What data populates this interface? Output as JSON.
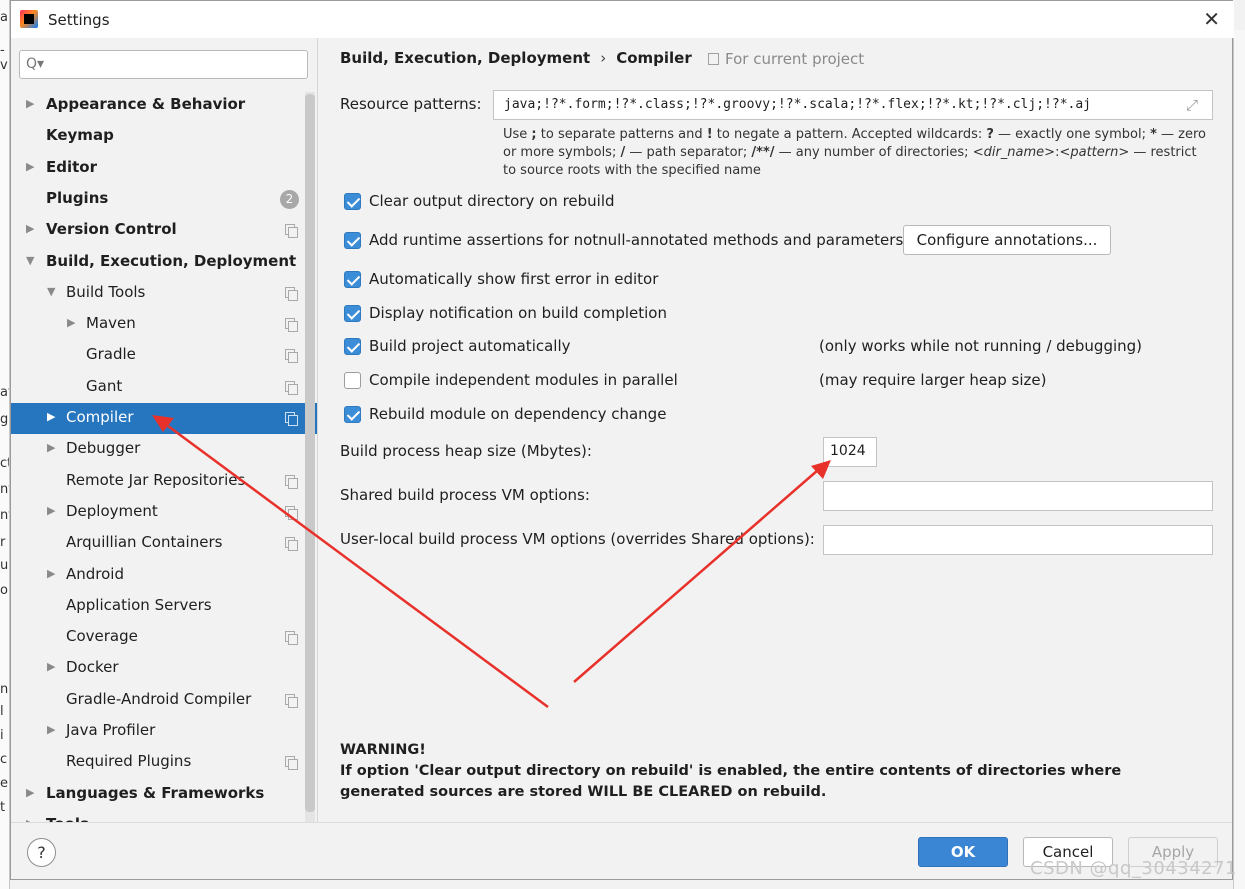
{
  "background": {
    "left_fragments": [
      "al",
      "-v",
      "at",
      "gu",
      "ct",
      "nt",
      "nf",
      "r",
      "ur",
      "o",
      "n",
      "l",
      "i",
      "c",
      "e",
      "t"
    ]
  },
  "window": {
    "title": "Settings",
    "close_glyph": "✕"
  },
  "sidebar": {
    "search_placeholder": "",
    "search_glyph": "Q▾",
    "items": [
      {
        "label": "Appearance & Behavior",
        "level": 0,
        "arrow": "▶",
        "bold": true
      },
      {
        "label": "Keymap",
        "level": 0,
        "bold": true
      },
      {
        "label": "Editor",
        "level": 0,
        "arrow": "▶",
        "bold": true
      },
      {
        "label": "Plugins",
        "level": 0,
        "bold": true,
        "badge": "2"
      },
      {
        "label": "Version Control",
        "level": 0,
        "arrow": "▶",
        "bold": true,
        "copy_icon": true
      },
      {
        "label": "Build, Execution, Deployment",
        "level": 0,
        "arrow": "▼",
        "bold": true
      },
      {
        "label": "Build Tools",
        "level": 1,
        "arrow": "▼",
        "copy_icon": true
      },
      {
        "label": "Maven",
        "level": 2,
        "arrow": "▶",
        "copy_icon": true
      },
      {
        "label": "Gradle",
        "level": 2,
        "copy_icon": true
      },
      {
        "label": "Gant",
        "level": 2,
        "copy_icon": true
      },
      {
        "label": "Compiler",
        "level": 1,
        "arrow": "▶",
        "copy_icon": true,
        "selected": true
      },
      {
        "label": "Debugger",
        "level": 1,
        "arrow": "▶"
      },
      {
        "label": "Remote Jar Repositories",
        "level": 1,
        "copy_icon": true
      },
      {
        "label": "Deployment",
        "level": 1,
        "arrow": "▶",
        "copy_icon": true
      },
      {
        "label": "Arquillian Containers",
        "level": 1,
        "copy_icon": true
      },
      {
        "label": "Android",
        "level": 1,
        "arrow": "▶"
      },
      {
        "label": "Application Servers",
        "level": 1
      },
      {
        "label": "Coverage",
        "level": 1,
        "copy_icon": true
      },
      {
        "label": "Docker",
        "level": 1,
        "arrow": "▶"
      },
      {
        "label": "Gradle-Android Compiler",
        "level": 1,
        "copy_icon": true
      },
      {
        "label": "Java Profiler",
        "level": 1,
        "arrow": "▶"
      },
      {
        "label": "Required Plugins",
        "level": 1,
        "copy_icon": true
      },
      {
        "label": "Languages & Frameworks",
        "level": 0,
        "arrow": "▶",
        "bold": true
      },
      {
        "label": "Tools",
        "level": 0,
        "arrow": "▶",
        "bold": true
      }
    ]
  },
  "main": {
    "breadcrumb": {
      "parent": "Build, Execution, Deployment",
      "separator": "›",
      "current": "Compiler"
    },
    "scope_label": "For current project",
    "resource_patterns": {
      "label": "Resource patterns:",
      "value": "java;!?*.form;!?*.class;!?*.groovy;!?*.scala;!?*.flex;!?*.kt;!?*.clj;!?*.aj",
      "expand_glyph": "⤢",
      "hint_html": "Use <b>;</b> to separate patterns and <b>!</b> to negate a pattern. Accepted wildcards: <b>?</b> — exactly one symbol; <b>*</b> — zero or more symbols; <b>/</b> — path separator; <b>/**/</b> — any number of directories; <i>&lt;dir_name&gt;</i>:<i>&lt;pattern&gt;</i> — restrict to source roots with the specified name"
    },
    "checkboxes": [
      {
        "label": "Clear output directory on rebuild",
        "checked": true
      },
      {
        "label": "Add runtime assertions for notnull-annotated methods and parameters",
        "checked": true
      },
      {
        "label": "Automatically show first error in editor",
        "checked": true
      },
      {
        "label": "Display notification on build completion",
        "checked": true
      },
      {
        "label": "Build project automatically",
        "checked": true,
        "note": "(only works while not running / debugging)"
      },
      {
        "label": "Compile independent modules in parallel",
        "checked": false,
        "note": "(may require larger heap size)"
      },
      {
        "label": "Rebuild module on dependency change",
        "checked": true
      }
    ],
    "configure_annotations_label": "Configure annotations...",
    "heap_size": {
      "label": "Build process heap size (Mbytes):",
      "value": "1024"
    },
    "shared_vm": {
      "label": "Shared build process VM options:",
      "value": ""
    },
    "user_vm": {
      "label": "User-local build process VM options (overrides Shared options):",
      "value": ""
    },
    "warning": {
      "title": "WARNING!",
      "text": "If option 'Clear output directory on rebuild' is enabled, the entire contents of directories where generated sources are stored WILL BE CLEARED on rebuild."
    }
  },
  "footer": {
    "help_glyph": "?",
    "ok_label": "OK",
    "cancel_label": "Cancel",
    "apply_label": "Apply"
  },
  "watermark": "CSDN @qq_30434271",
  "colors": {
    "selection": "#2675bf",
    "checkbox": "#3c8dd8",
    "ok_button": "#3b86d4",
    "annotation_arrow": "#e8312a"
  }
}
